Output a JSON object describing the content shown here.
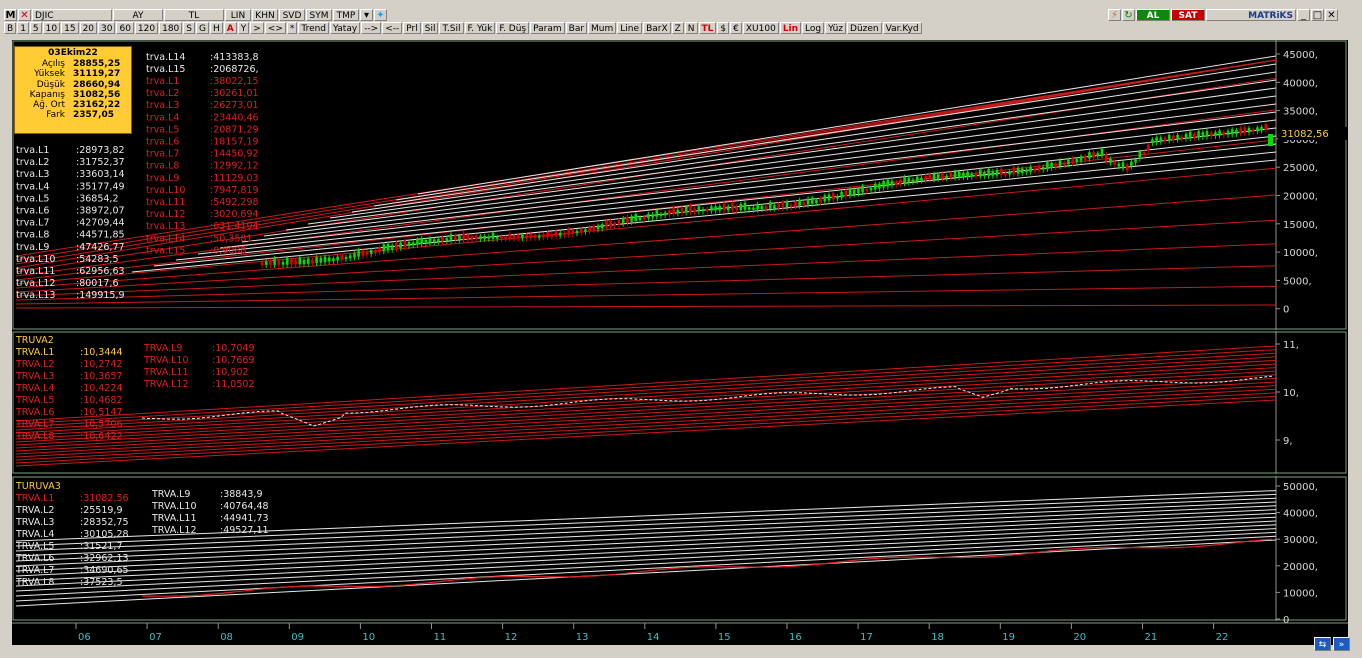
{
  "toolbar1": {
    "symbol": "DJIC",
    "periods": [
      "AY",
      "TL",
      "LIN",
      "KHN",
      "SVD",
      "SYM",
      "TMP"
    ],
    "right_al": "AL",
    "right_sat": "SAT",
    "brand": "MATRiKS"
  },
  "toolbar2": {
    "intervals": [
      "B",
      "1",
      "5",
      "10",
      "15",
      "20",
      "30",
      "60",
      "120",
      "180",
      "S",
      "G",
      "H",
      "A",
      "Y"
    ],
    "nav": [
      ">",
      "<>",
      "*"
    ],
    "tools": [
      "Trend",
      "Yatay",
      "-->",
      "<--",
      "Prl",
      "Sil",
      "T.Sil",
      "F. Yük",
      "F. Düş",
      "Param",
      "Bar",
      "Mum",
      "Line",
      "BarX",
      "Z",
      "N",
      "TL",
      "$",
      "€",
      "XU100",
      "Lin",
      "Log",
      "Yüz",
      "Düzen",
      "Var.Kyd"
    ]
  },
  "ohlc": {
    "date": "03Ekim22",
    "rows": [
      {
        "k": "Açılış",
        "v": "28855,25"
      },
      {
        "k": "Yüksek",
        "v": "31119,27"
      },
      {
        "k": "Düşük",
        "v": "28660,94"
      },
      {
        "k": "Kapanış",
        "v": "31082,56"
      },
      {
        "k": "Ağ. Ort",
        "v": "23162,22"
      },
      {
        "k": "Fark",
        "v": "2357,05"
      }
    ]
  },
  "panel1": {
    "left_labels": [
      {
        "name": "trva.L1",
        "val": ":28973,82"
      },
      {
        "name": "trva.L2",
        "val": ":31752,37"
      },
      {
        "name": "trva.L3",
        "val": ":33603,14"
      },
      {
        "name": "trva.L4",
        "val": ":35177,49"
      },
      {
        "name": "trva.L5",
        "val": ":36854,2"
      },
      {
        "name": "trva.L6",
        "val": ":38972,07"
      },
      {
        "name": "trva.L7",
        "val": ":42709,44"
      },
      {
        "name": "trva.L8",
        "val": ":44571,85"
      },
      {
        "name": "trva.L9",
        "val": ":47426,77"
      },
      {
        "name": "trva.L10",
        "val": ":54283,5"
      },
      {
        "name": "trva.L11",
        "val": ":62956,63"
      },
      {
        "name": "trva.L12",
        "val": ":80017,6"
      },
      {
        "name": "trva.L13",
        "val": ":149915,9"
      }
    ],
    "mid_white": [
      {
        "name": "trva.L14",
        "val": ":413383,8"
      },
      {
        "name": "trva.L15",
        "val": ":2068726,"
      }
    ],
    "mid_red": [
      {
        "name": "trva.L1",
        "val": ":38022,15"
      },
      {
        "name": "trva.L2",
        "val": ":30261,01"
      },
      {
        "name": "trva.L3",
        "val": ":26273,01"
      },
      {
        "name": "trva.L4",
        "val": ":23440,46"
      },
      {
        "name": "trva.L5",
        "val": ":20871,29"
      },
      {
        "name": "trva.L6",
        "val": ":18157,19"
      },
      {
        "name": "trva.L7",
        "val": ":14450,92"
      },
      {
        "name": "trva.L8",
        "val": ":12992,12"
      },
      {
        "name": "trva.L9",
        "val": ":11129,03"
      },
      {
        "name": "trva.L10",
        "val": ":7947,819"
      },
      {
        "name": "trva.L11",
        "val": ":5492,298"
      },
      {
        "name": "trva.L12",
        "val": ":3020,694"
      },
      {
        "name": "trva.L13",
        "val": ":631,4194"
      },
      {
        "name": "trva.L14",
        "val": ":50,3581"
      },
      {
        "name": "trva.L15",
        "val": ":0,9088"
      }
    ],
    "y_ticks": [
      "45000,",
      "40000,",
      "35000,",
      "30000,",
      "25000,",
      "20000,",
      "15000,",
      "10000,",
      "5000,",
      "0"
    ],
    "last_price": "31082,56"
  },
  "panel2": {
    "title": "TRUVA2",
    "left": [
      {
        "name": "TRVA.L1",
        "val": ":10,3444",
        "red": false
      },
      {
        "name": "TRVA.L2",
        "val": ":10,2742",
        "red": true
      },
      {
        "name": "TRVA.L3",
        "val": ":10,3657",
        "red": true
      },
      {
        "name": "TRVA.L4",
        "val": ":10,4224",
        "red": true
      },
      {
        "name": "TRVA.L5",
        "val": ":10,4682",
        "red": true
      },
      {
        "name": "TRVA.L6",
        "val": ":10,5147",
        "red": true
      },
      {
        "name": "TRVA.L7",
        "val": ":10,5706",
        "red": true
      },
      {
        "name": "TRVA.L8",
        "val": ":10,6422",
        "red": true
      }
    ],
    "right": [
      {
        "name": "TRVA.L9",
        "val": ":10,7049"
      },
      {
        "name": "TRVA.L10",
        "val": ":10,7669"
      },
      {
        "name": "TRVA.L11",
        "val": ":10,902"
      },
      {
        "name": "TRVA.L12",
        "val": ":11,0502"
      }
    ],
    "y_ticks": [
      "11,",
      "10,",
      "9,"
    ]
  },
  "panel3": {
    "title": "TURUVA3",
    "left": [
      {
        "name": "TRVA.L1",
        "val": ":31082,56",
        "red": true
      },
      {
        "name": "TRVA.L2",
        "val": ":25519,9",
        "red": false
      },
      {
        "name": "TRVA.L3",
        "val": ":28352,75",
        "red": false
      },
      {
        "name": "TRVA.L4",
        "val": ":30105,28",
        "red": false
      },
      {
        "name": "TRVA.L5",
        "val": ":31521,7",
        "red": false
      },
      {
        "name": "TRVA.L6",
        "val": ":32962,13",
        "red": false
      },
      {
        "name": "TRVA.L7",
        "val": ":34690,65",
        "red": false
      },
      {
        "name": "TRVA.L8",
        "val": ":37523,5",
        "red": false
      }
    ],
    "right": [
      {
        "name": "TRVA.L9",
        "val": ":38843,9"
      },
      {
        "name": "TRVA.L10",
        "val": ":40764,48"
      },
      {
        "name": "TRVA.L11",
        "val": ":44941,73"
      },
      {
        "name": "TRVA.L12",
        "val": ":49527,11"
      }
    ],
    "y_ticks": [
      "50000,",
      "40000,",
      "30000,",
      "20000,",
      "10000,",
      "0"
    ]
  },
  "x_ticks": [
    "06",
    "07",
    "08",
    "09",
    "10",
    "11",
    "12",
    "13",
    "14",
    "15",
    "16",
    "17",
    "18",
    "19",
    "20",
    "21",
    "22"
  ],
  "colors": {
    "background": "#000000",
    "grid_border": "#7f9f7f",
    "up": "#00dd00",
    "down": "#dd0000",
    "red_line": "#cc1a1a",
    "white_line": "#e8e8e8",
    "axis_text": "#d8d8d8",
    "ohlc_bg": "#ffcc33"
  }
}
